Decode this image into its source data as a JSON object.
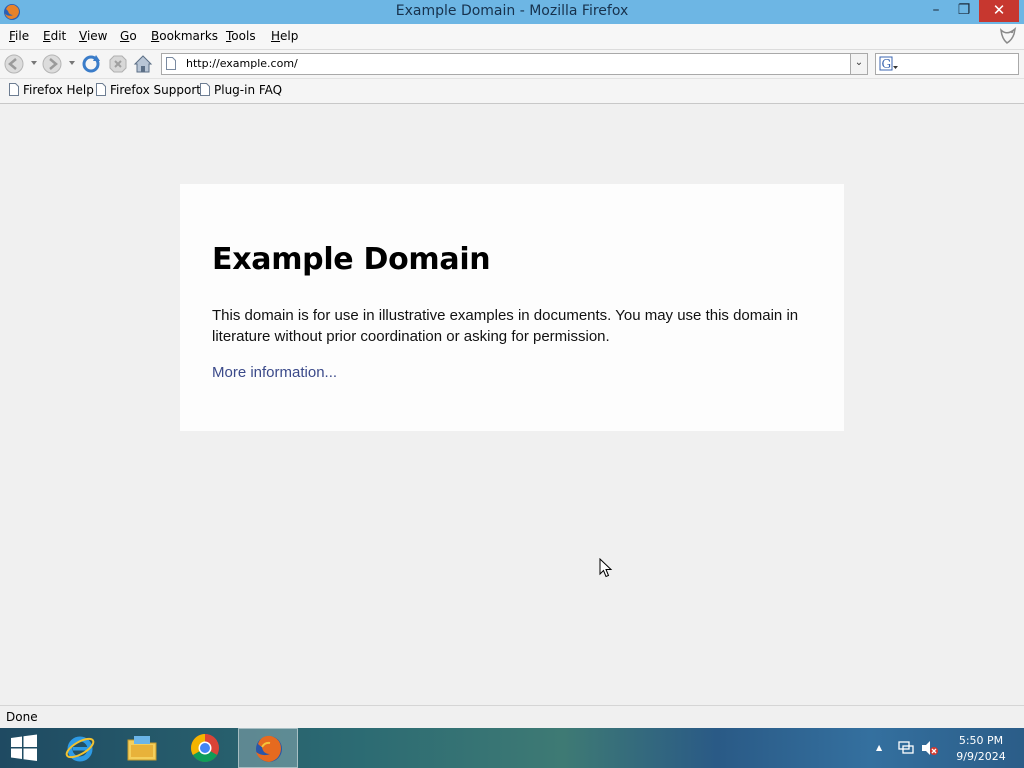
{
  "window": {
    "title": "Example Domain - Mozilla Firefox",
    "minimize_label": "–",
    "maximize_label": "❐",
    "close_label": "✕"
  },
  "menu": {
    "items": [
      {
        "first": "F",
        "rest": "ile"
      },
      {
        "first": "E",
        "rest": "dit"
      },
      {
        "first": "V",
        "rest": "iew"
      },
      {
        "first": "G",
        "rest": "o"
      },
      {
        "first": "B",
        "rest": "ookmarks"
      },
      {
        "first": "T",
        "rest": "ools"
      },
      {
        "first": "H",
        "rest": "elp"
      }
    ]
  },
  "navbar": {
    "url": "http://example.com/",
    "url_dropdown": "⌄",
    "search_value": ""
  },
  "bookmarks": {
    "items": [
      "Firefox Help",
      "Firefox Support",
      "Plug-in FAQ"
    ]
  },
  "page": {
    "heading": "Example Domain",
    "body": "This domain is for use in illustrative examples in documents. You may use this domain in literature without prior coordination or asking for permission.",
    "link": "More information..."
  },
  "status": {
    "text": "Done"
  },
  "taskbar": {
    "time": "5:50 PM",
    "date": "9/9/2024",
    "tray_arrow": "▲"
  },
  "colors": {
    "titlebar": "#6db6e4",
    "close_button": "#c7372f",
    "link": "#3b4a8a",
    "page_background": "#f0f0f0"
  }
}
